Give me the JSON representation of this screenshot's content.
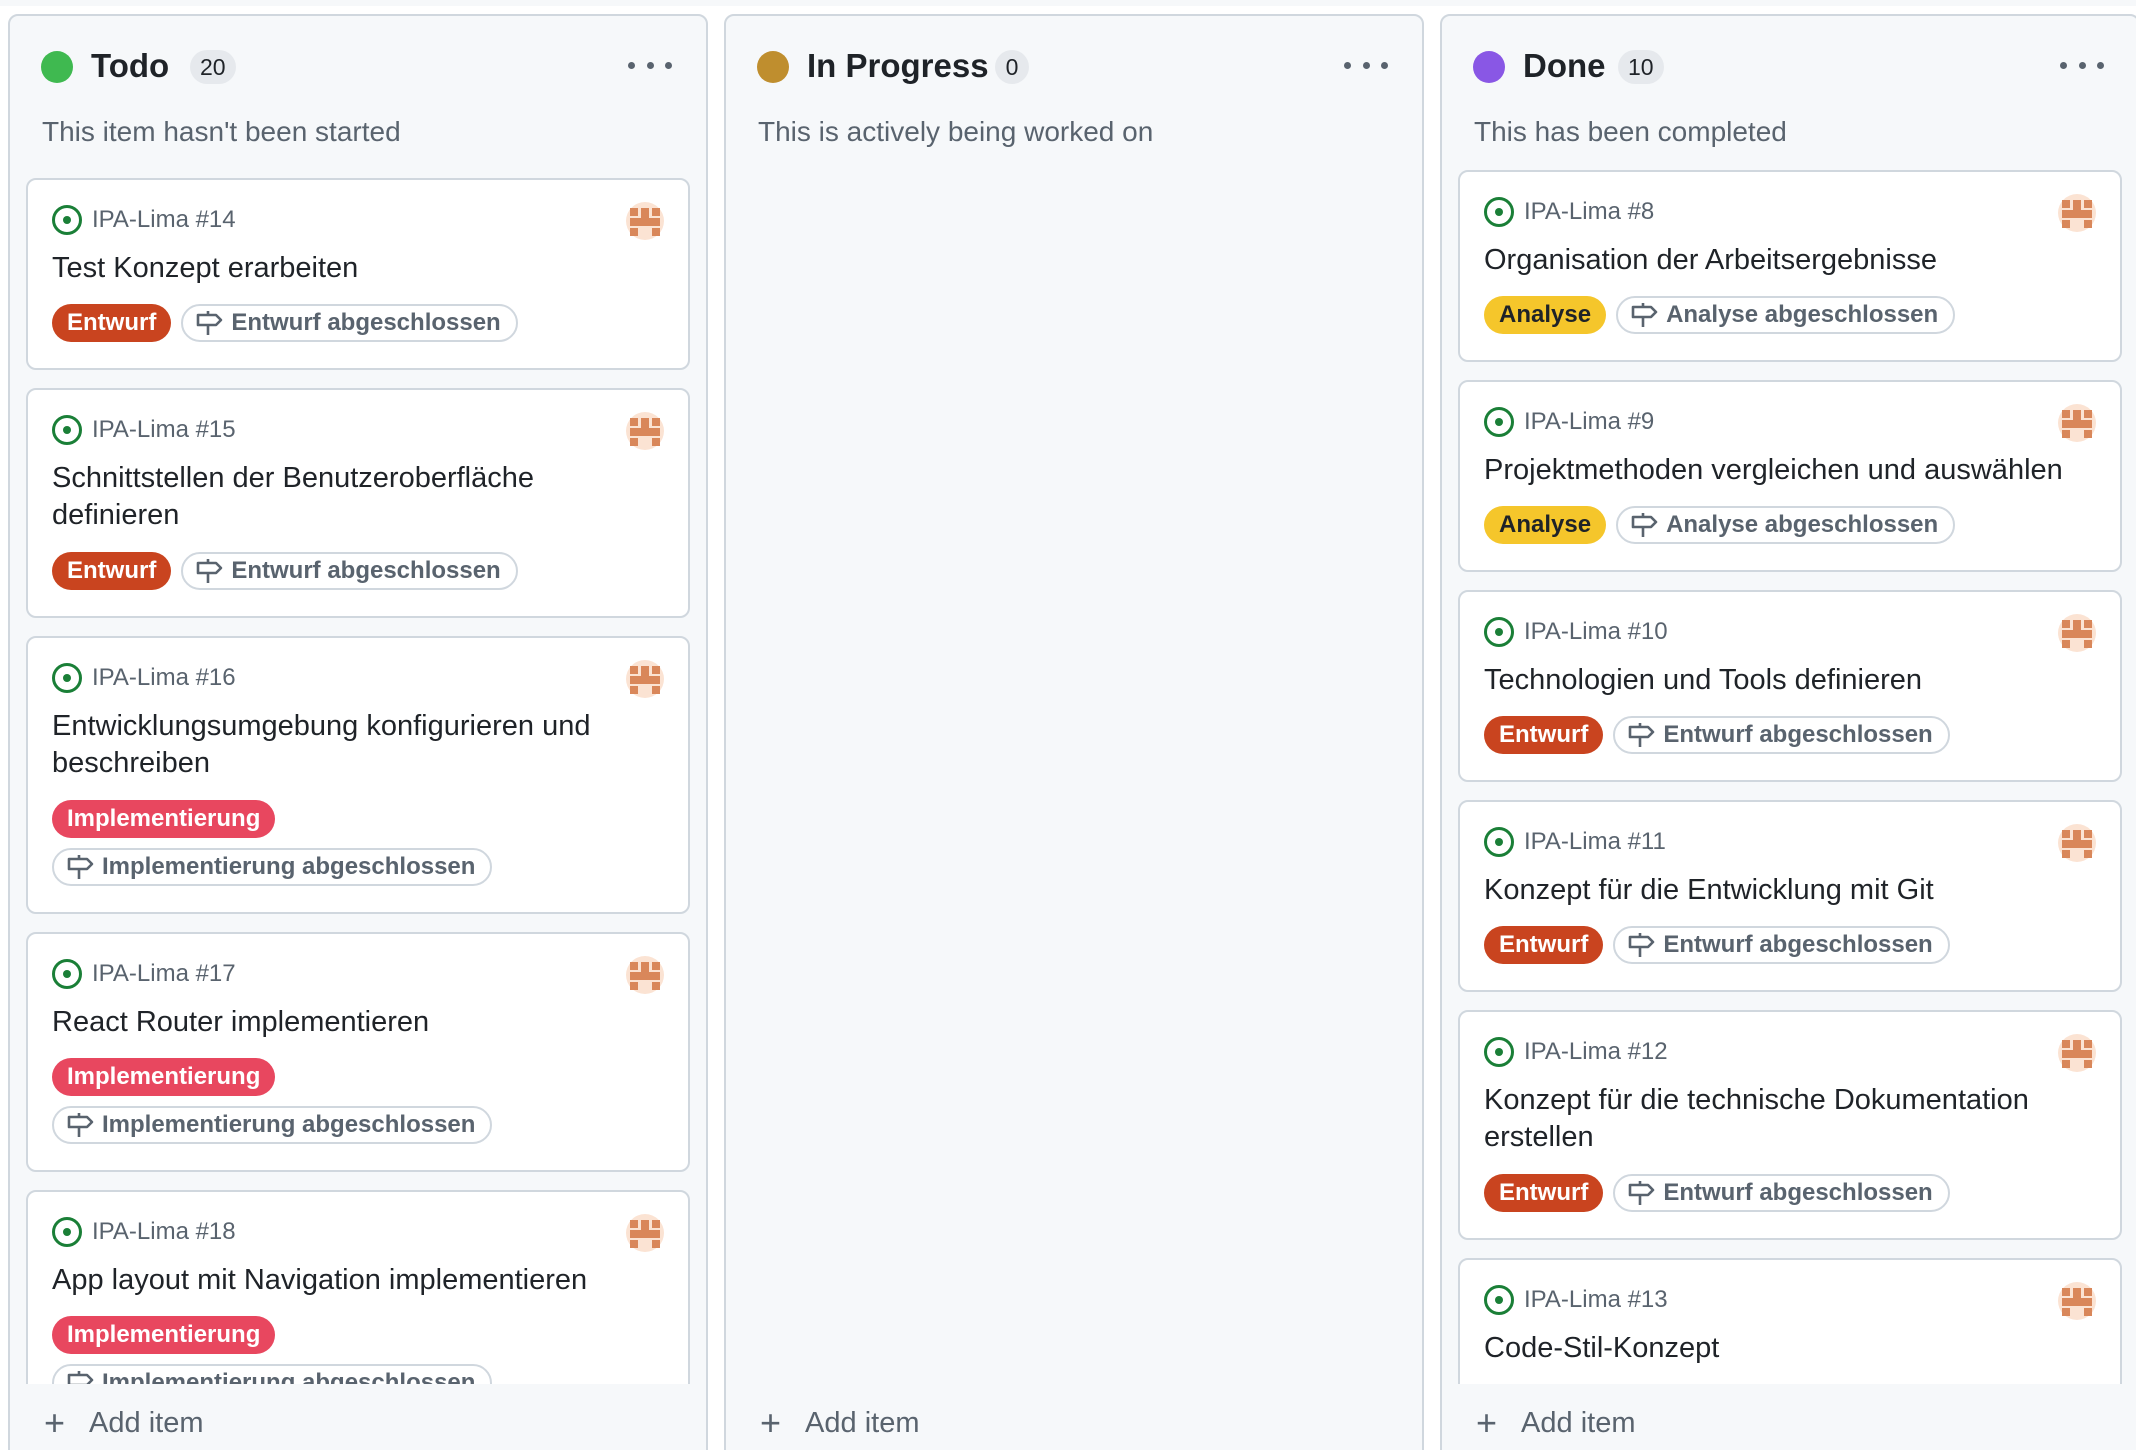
{
  "colors": {
    "todo": "#3fb950",
    "in_progress": "#bf8e2e",
    "done": "#8957e5",
    "issue_open": "#1a7f37",
    "label_entwurf": "#c9441f",
    "label_implementierung": "#e8475f",
    "label_analyse": "#f5c62b"
  },
  "icons": {
    "issue": "issue-opened-icon",
    "milestone": "milestone-icon",
    "avatar": "avatar-identicon",
    "menu": "kebab-horizontal-icon",
    "add": "plus-icon"
  },
  "columns": [
    {
      "title": "Todo",
      "count": "20",
      "description": "This item hasn't been started",
      "add_label": "Add item",
      "cards": [
        {
          "repo": "IPA-Lima #14",
          "title": "Test Konzept erarbeiten",
          "label": "Entwurf",
          "milestone": "Entwurf abgeschlossen"
        },
        {
          "repo": "IPA-Lima #15",
          "title": "Schnittstellen der Benutzeroberfläche definieren",
          "label": "Entwurf",
          "milestone": "Entwurf abgeschlossen"
        },
        {
          "repo": "IPA-Lima #16",
          "title": "Entwicklungsumgebung konfigurieren und beschreiben",
          "label": "Implementierung",
          "milestone": "Implementierung abgeschlossen"
        },
        {
          "repo": "IPA-Lima #17",
          "title": "React Router implementieren",
          "label": "Implementierung",
          "milestone": "Implementierung abgeschlossen"
        },
        {
          "repo": "IPA-Lima #18",
          "title": "App layout mit Navigation implementieren",
          "label": "Implementierung",
          "milestone": "Implementierung abgeschlossen"
        }
      ]
    },
    {
      "title": "In Progress",
      "count": "0",
      "description": "This is actively being worked on",
      "add_label": "Add item",
      "cards": []
    },
    {
      "title": "Done",
      "count": "10",
      "description": "This has been completed",
      "add_label": "Add item",
      "cards": [
        {
          "repo": "IPA-Lima #8",
          "title": "Organisation der Arbeitsergebnisse",
          "label": "Analyse",
          "milestone": "Analyse abgeschlossen"
        },
        {
          "repo": "IPA-Lima #9",
          "title": "Projektmethoden vergleichen und auswählen",
          "label": "Analyse",
          "milestone": "Analyse abgeschlossen"
        },
        {
          "repo": "IPA-Lima #10",
          "title": "Technologien und Tools definieren",
          "label": "Entwurf",
          "milestone": "Entwurf abgeschlossen"
        },
        {
          "repo": "IPA-Lima #11",
          "title": "Konzept für die Entwicklung mit Git",
          "label": "Entwurf",
          "milestone": "Entwurf abgeschlossen"
        },
        {
          "repo": "IPA-Lima #12",
          "title": "Konzept für die technische Dokumentation erstellen",
          "label": "Entwurf",
          "milestone": "Entwurf abgeschlossen"
        },
        {
          "repo": "IPA-Lima #13",
          "title": "Code-Stil-Konzept",
          "label": "",
          "milestone": ""
        }
      ]
    }
  ]
}
